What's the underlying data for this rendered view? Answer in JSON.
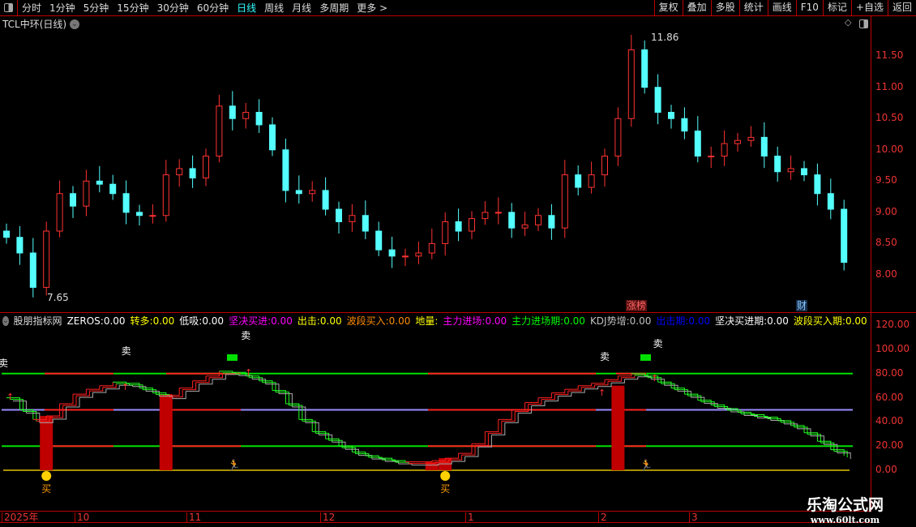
{
  "toolbar": {
    "periods": [
      "分时",
      "1分钟",
      "5分钟",
      "15分钟",
      "30分钟",
      "60分钟",
      "日线",
      "周线",
      "月线",
      "多周期",
      "更多 >"
    ],
    "active": "日线",
    "buttons": [
      "复权",
      "叠加",
      "多股",
      "统计",
      "画线",
      "F10",
      "标记",
      "+自选",
      "返回"
    ]
  },
  "chart_title": "TCL中环(日线)",
  "price_axis": [
    "11.50",
    "11.00",
    "10.50",
    "10.00",
    "9.50",
    "9.00",
    "8.50",
    "8.00"
  ],
  "price_annotations": {
    "high": "11.86",
    "low": "7.65",
    "tag_limit": "涨榜",
    "tag_fin": "财"
  },
  "indicator": {
    "name": "股朋指标网",
    "items": [
      {
        "label": "ZEROS:",
        "value": "0.00",
        "color": "#ffffff"
      },
      {
        "label": "转多:",
        "value": "0.00",
        "color": "#ffff00"
      },
      {
        "label": "低吸:",
        "value": "0.00",
        "color": "#ffffff"
      },
      {
        "label": "坚决买进:",
        "value": "0.00",
        "color": "#ff00ff"
      },
      {
        "label": "出击:",
        "value": "0.00",
        "color": "#ffff00"
      },
      {
        "label": "波段买入:",
        "value": "0.00",
        "color": "#ff8c00"
      },
      {
        "label": "地量:",
        "value": "",
        "color": "#ffff00"
      },
      {
        "label": "主力进场:",
        "value": "0.00",
        "color": "#ff00ff"
      },
      {
        "label": "主力进场期:",
        "value": "0.00",
        "color": "#00ff00"
      },
      {
        "label": "KDJ势增:",
        "value": "0.00",
        "color": "#c0c0c0"
      },
      {
        "label": "出击期:",
        "value": "0.00",
        "color": "#0000ff"
      },
      {
        "label": "坚决买进期:",
        "value": "0.00",
        "color": "#ffffff"
      },
      {
        "label": "波段买入期:",
        "value": "0.00",
        "color": "#ffff00"
      },
      {
        "label": "转多",
        "value": "",
        "color": "#ff00ff"
      }
    ]
  },
  "osc_axis": [
    "120.00",
    "100.00",
    "80.00",
    "60.00",
    "40.00",
    "20.00",
    "0.00"
  ],
  "signals": {
    "sell": "卖",
    "buy": "买"
  },
  "dates": [
    "2025年",
    "10",
    "11",
    "12",
    "1",
    "2",
    "3"
  ],
  "watermark": {
    "name": "乐淘公式网",
    "url": "www.60lt.com"
  },
  "chart_data": {
    "type": "candlestick",
    "closes": [
      8.6,
      8.35,
      7.8,
      8.7,
      9.3,
      9.1,
      9.5,
      9.45,
      9.3,
      9.0,
      8.95,
      8.95,
      9.6,
      9.7,
      9.55,
      9.9,
      10.7,
      10.5,
      10.6,
      10.4,
      10.0,
      9.35,
      9.3,
      9.35,
      9.05,
      8.85,
      8.95,
      8.7,
      8.4,
      8.3,
      8.3,
      8.35,
      8.5,
      8.85,
      8.7,
      8.9,
      9.0,
      9.0,
      8.75,
      8.8,
      8.95,
      8.75,
      9.6,
      9.4,
      9.6,
      9.9,
      10.5,
      11.6,
      11.0,
      10.6,
      10.5,
      10.3,
      9.9,
      9.9,
      10.1,
      10.15,
      10.2,
      9.9,
      9.65,
      9.7,
      9.6,
      9.3,
      9.05,
      8.2
    ],
    "ylim": [
      7.6,
      12.0
    ],
    "oscillator": [
      60,
      50,
      42,
      45,
      55,
      63,
      67,
      70,
      73,
      72,
      68,
      64,
      62,
      68,
      74,
      78,
      82,
      81,
      78,
      74,
      66,
      55,
      42,
      32,
      26,
      20,
      15,
      12,
      10,
      8,
      7,
      7,
      8,
      10,
      14,
      22,
      32,
      42,
      50,
      56,
      60,
      64,
      67,
      70,
      72,
      75,
      78,
      80,
      78,
      73,
      68,
      63,
      58,
      54,
      51,
      48,
      46,
      44,
      41,
      37,
      31,
      24,
      17,
      12
    ],
    "osc_ylim": [
      0,
      120
    ],
    "osc_levels": [
      80,
      50,
      20,
      0
    ],
    "bars": [
      {
        "i": 3,
        "v": 45
      },
      {
        "i": 12,
        "v": 63
      },
      {
        "i": 32,
        "v": 7
      },
      {
        "i": 33,
        "v": 10
      },
      {
        "i": 46,
        "v": 70
      }
    ],
    "buy_at": [
      3,
      33
    ],
    "sell_at": [
      0,
      9,
      18,
      45,
      49
    ],
    "runner_at": [
      17,
      48
    ]
  }
}
